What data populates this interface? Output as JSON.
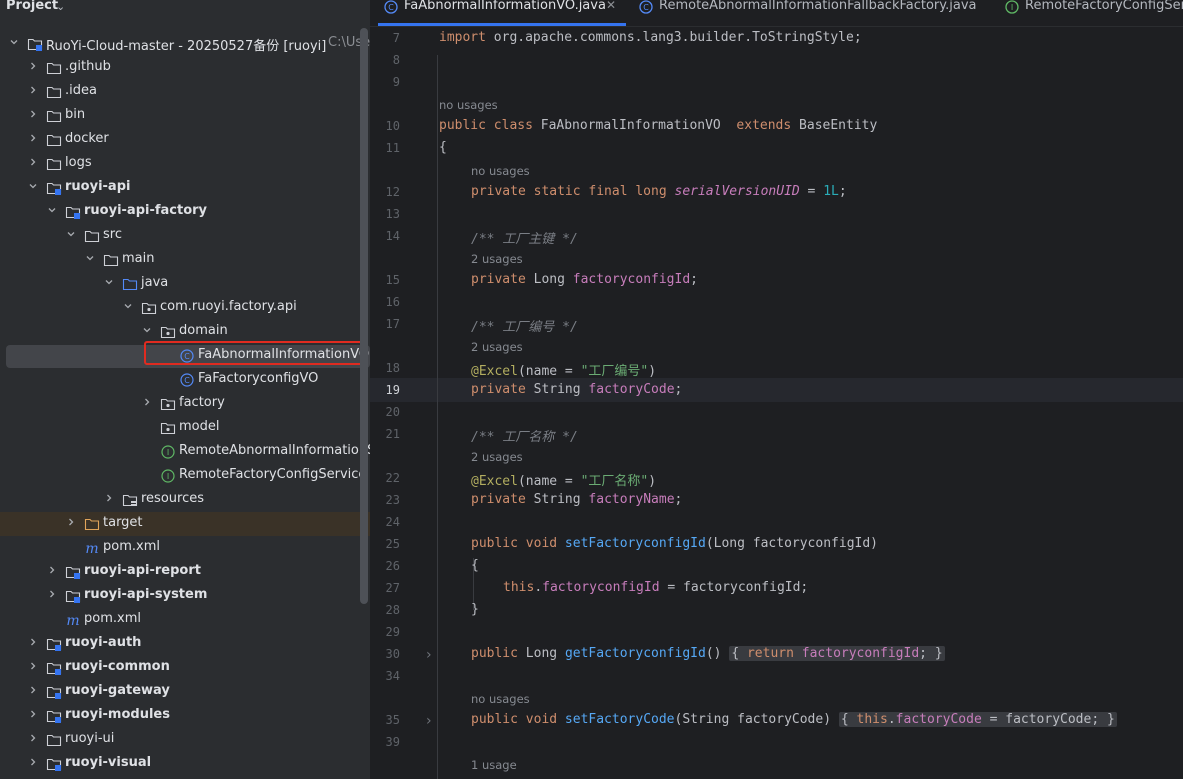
{
  "project_panel": {
    "title": "Project",
    "tree": [
      {
        "label": "RuoYi-Cloud-master - 20250527备份 [ruoyi]",
        "sublabel": " C:\\Users",
        "bold": false,
        "icon": "module-folder-icon",
        "arrow": "down"
      },
      {
        "label": ".github",
        "icon": "folder-icon",
        "arrow": "right"
      },
      {
        "label": ".idea",
        "icon": "folder-icon",
        "arrow": "right"
      },
      {
        "label": "bin",
        "icon": "folder-icon",
        "arrow": "right"
      },
      {
        "label": "docker",
        "icon": "folder-icon",
        "arrow": "right"
      },
      {
        "label": "logs",
        "icon": "folder-icon",
        "arrow": "right"
      },
      {
        "label": "ruoyi-api",
        "icon": "module-folder-icon",
        "arrow": "down",
        "bold": true
      },
      {
        "label": "ruoyi-api-factory",
        "icon": "module-folder-icon",
        "arrow": "down",
        "bold": true
      },
      {
        "label": "src",
        "icon": "folder-icon",
        "arrow": "down"
      },
      {
        "label": "main",
        "icon": "folder-icon",
        "arrow": "down"
      },
      {
        "label": "java",
        "icon": "source-folder-icon",
        "arrow": "down"
      },
      {
        "label": "com.ruoyi.factory.api",
        "icon": "package-icon",
        "arrow": "down"
      },
      {
        "label": "domain",
        "icon": "package-icon",
        "arrow": "down"
      },
      {
        "label": "FaAbnormalInformationVO",
        "icon": "class-icon",
        "arrow": "none",
        "selected": true
      },
      {
        "label": "FaFactoryconfigVO",
        "icon": "class-icon",
        "arrow": "none"
      },
      {
        "label": "factory",
        "icon": "package-icon",
        "arrow": "right"
      },
      {
        "label": "model",
        "icon": "package-icon",
        "arrow": "none"
      },
      {
        "label": "RemoteAbnormalInformationService",
        "icon": "interface-icon",
        "arrow": "none"
      },
      {
        "label": "RemoteFactoryConfigService",
        "icon": "interface-icon",
        "arrow": "none"
      },
      {
        "label": "resources",
        "icon": "resources-folder-icon",
        "arrow": "right"
      },
      {
        "label": "target",
        "icon": "excluded-folder-icon",
        "arrow": "right",
        "highlight": true
      },
      {
        "label": "pom.xml",
        "icon": "maven-icon",
        "arrow": "none"
      },
      {
        "label": "ruoyi-api-report",
        "icon": "module-folder-icon",
        "arrow": "right",
        "bold": true
      },
      {
        "label": "ruoyi-api-system",
        "icon": "module-folder-icon",
        "arrow": "right",
        "bold": true
      },
      {
        "label": "pom.xml",
        "icon": "maven-icon",
        "arrow": "none"
      },
      {
        "label": "ruoyi-auth",
        "icon": "module-folder-icon",
        "arrow": "right",
        "bold": true
      },
      {
        "label": "ruoyi-common",
        "icon": "module-folder-icon",
        "arrow": "right",
        "bold": true
      },
      {
        "label": "ruoyi-gateway",
        "icon": "module-folder-icon",
        "arrow": "right",
        "bold": true
      },
      {
        "label": "ruoyi-modules",
        "icon": "module-folder-icon",
        "arrow": "right",
        "bold": true
      },
      {
        "label": "ruoyi-ui",
        "icon": "folder-icon",
        "arrow": "right"
      },
      {
        "label": "ruoyi-visual",
        "icon": "module-folder-icon",
        "arrow": "right",
        "bold": true
      }
    ]
  },
  "tabs": [
    {
      "label": "FaAbnormalInformationVO.java",
      "icon": "class-icon",
      "active": true,
      "closable": true
    },
    {
      "label": "RemoteAbnormalInformationFallbackFactory.java",
      "icon": "class-icon",
      "active": false
    },
    {
      "label": "RemoteFactoryConfigService.java",
      "icon": "interface-icon",
      "active": false
    }
  ],
  "editor": {
    "current_line_number": "19",
    "line_numbers": [
      "7",
      "8",
      "9",
      "10",
      "11",
      "12",
      "13",
      "14",
      "15",
      "16",
      "17",
      "18",
      "19",
      "20",
      "21",
      "22",
      "23",
      "24",
      "25",
      "26",
      "27",
      "28",
      "29",
      "30",
      "34",
      "35",
      "39"
    ],
    "hints": {
      "h1": "no usages",
      "h2": "no usages",
      "h3": "2 usages",
      "h4": "2 usages",
      "h5": "2 usages",
      "h6": "no usages",
      "h7": "1 usage"
    },
    "code": {
      "l7": {
        "kw": "import",
        "rest": " org.apache.commons.lang3.builder.ToStringStyle;"
      },
      "l10": {
        "kw1": "public class",
        "name": " FaAbnormalInformationVO ",
        "kw2": " extends",
        "rest": " BaseEntity"
      },
      "l11": "{",
      "l12": {
        "kw": "private static final long",
        "field": "serialVersionUID",
        "eq": " = ",
        "num": "1L",
        "semi": ";"
      },
      "l14": "/** 工厂主键 */",
      "l15": {
        "kw": "private",
        "type": " Long ",
        "field": "factoryconfigId",
        "semi": ";"
      },
      "l17": "/** 工厂编号 */",
      "l18": {
        "ann": "@Excel",
        "mid": "(name = ",
        "str": "\"工厂编号\"",
        "end": ")"
      },
      "l19": {
        "kw": "private",
        "type": " String ",
        "field": "factoryCode",
        "semi": ";"
      },
      "l21": "/** 工厂名称 */",
      "l22": {
        "ann": "@Excel",
        "mid": "(name = ",
        "str": "\"工厂名称\"",
        "end": ")"
      },
      "l23": {
        "kw": "private",
        "type": " String ",
        "field": "factoryName",
        "semi": ";"
      },
      "l25": {
        "kw": "public void",
        "method": "setFactoryconfigId",
        "rest": "(Long factoryconfigId)"
      },
      "l26": "{",
      "l27": {
        "kw": "this",
        "dot": ".",
        "field": "factoryconfigId",
        "rest": " = factoryconfigId;"
      },
      "l28": "}",
      "l30": {
        "kw": "public",
        "type": " Long ",
        "method": "getFactoryconfigId",
        "paren": "()",
        "open": "{",
        "kw2": " return ",
        "field": "factoryconfigId",
        "semi": ";",
        "close": "}"
      },
      "l35": {
        "kw": "public void",
        "method": "setFactoryCode",
        "rest": "(String factoryCode)",
        "open": "{",
        "kw2": " this",
        "dot": ".",
        "field": "factoryCode",
        "rest2": " = factoryCode;",
        "close": "}"
      }
    }
  },
  "colors": {
    "panel_bg": "#2b2d30",
    "editor_bg": "#1e1f22",
    "keyword": "#cf8e6d",
    "field": "#c77dbb",
    "method": "#56a8f5",
    "string": "#6aab73",
    "selection_border": "#e02b20",
    "accent": "#3574f0"
  }
}
